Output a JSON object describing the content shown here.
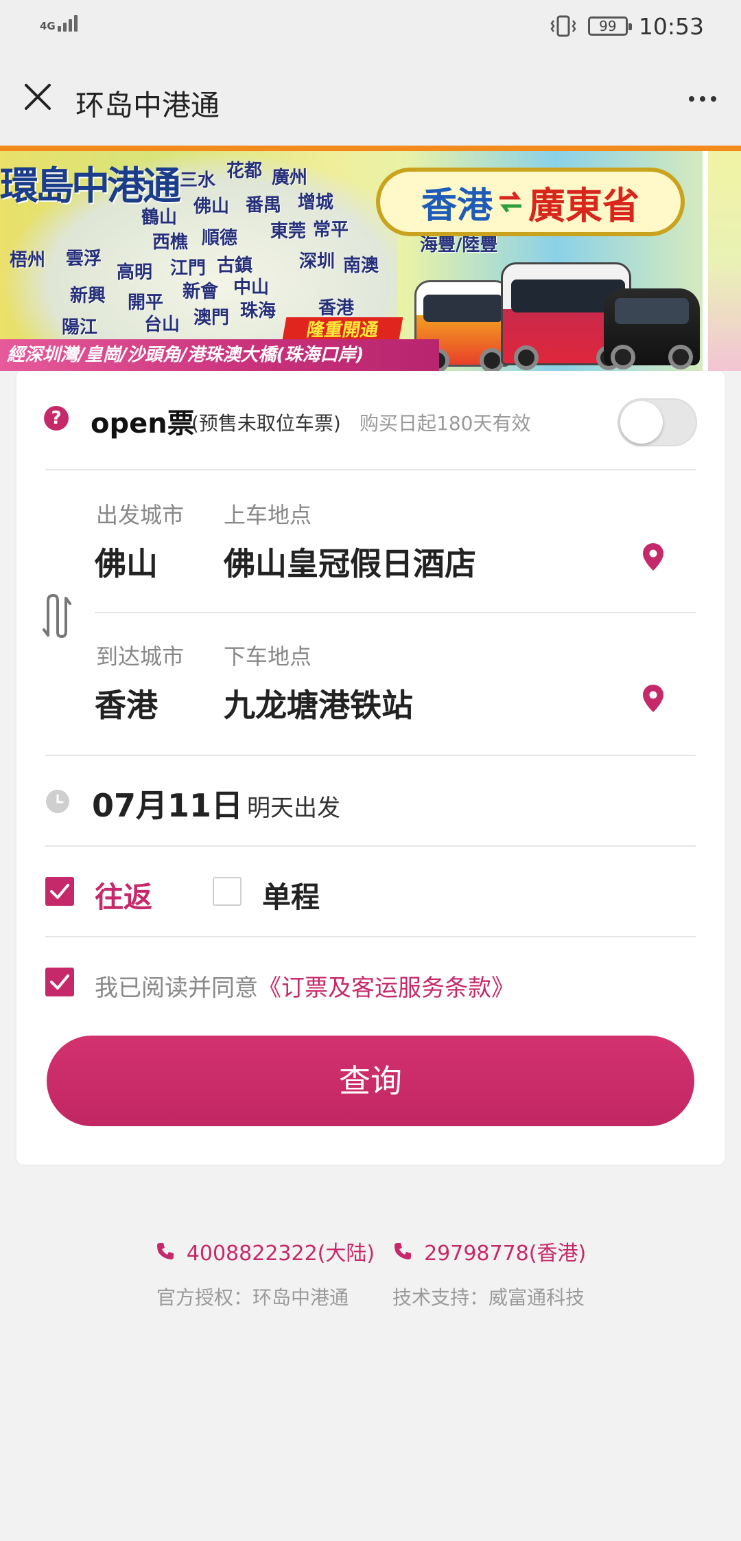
{
  "status_bar": {
    "network": "4G",
    "battery": "99",
    "time": "10:53"
  },
  "nav": {
    "title": "环岛中港通"
  },
  "banner": {
    "logo_text": "環島中港通",
    "route_a": "香港",
    "route_b": "廣東省",
    "cities": [
      "三水",
      "花都",
      "廣州",
      "佛山",
      "番禺",
      "增城",
      "鶴山",
      "西樵",
      "順德",
      "東莞",
      "常平",
      "梧州",
      "雲浮",
      "高明",
      "江門",
      "古鎮",
      "深圳",
      "南澳",
      "新興",
      "開平",
      "新會",
      "中山",
      "陽江",
      "台山",
      "澳門",
      "珠海",
      "香港",
      "海豐/陸豐"
    ],
    "tag": "隆重開通",
    "bottom_text": "經深圳灣/皇崗/沙頭角/港珠澳大橋(珠海口岸)"
  },
  "open_ticket": {
    "help_icon": "?",
    "title": "open票",
    "subtitle": "(预售未取位车票)",
    "validity": "购买日起180天有效",
    "enabled": false
  },
  "route": {
    "depart": {
      "city_label": "出发城市",
      "point_label": "上车地点",
      "city": "佛山",
      "point": "佛山皇冠假日酒店"
    },
    "arrive": {
      "city_label": "到达城市",
      "point_label": "下车地点",
      "city": "香港",
      "point": "九龙塘港铁站"
    }
  },
  "date": {
    "value": "07月11日",
    "note": "明天出发"
  },
  "trip_type": {
    "round_trip": "往返",
    "one_way": "单程",
    "selected": "round_trip"
  },
  "agreement": {
    "prefix": "我已阅读并同意",
    "link": "《订票及客运服务条款》",
    "checked": true
  },
  "query_button": "查询",
  "footer": {
    "phone_mainland": "4008822322(大陆)",
    "phone_hk": "29798778(香港)",
    "authorized": "官方授权：环岛中港通",
    "support": "技术支持：威富通科技"
  },
  "colors": {
    "accent": "#c6296a",
    "background": "#f2f2f2"
  }
}
